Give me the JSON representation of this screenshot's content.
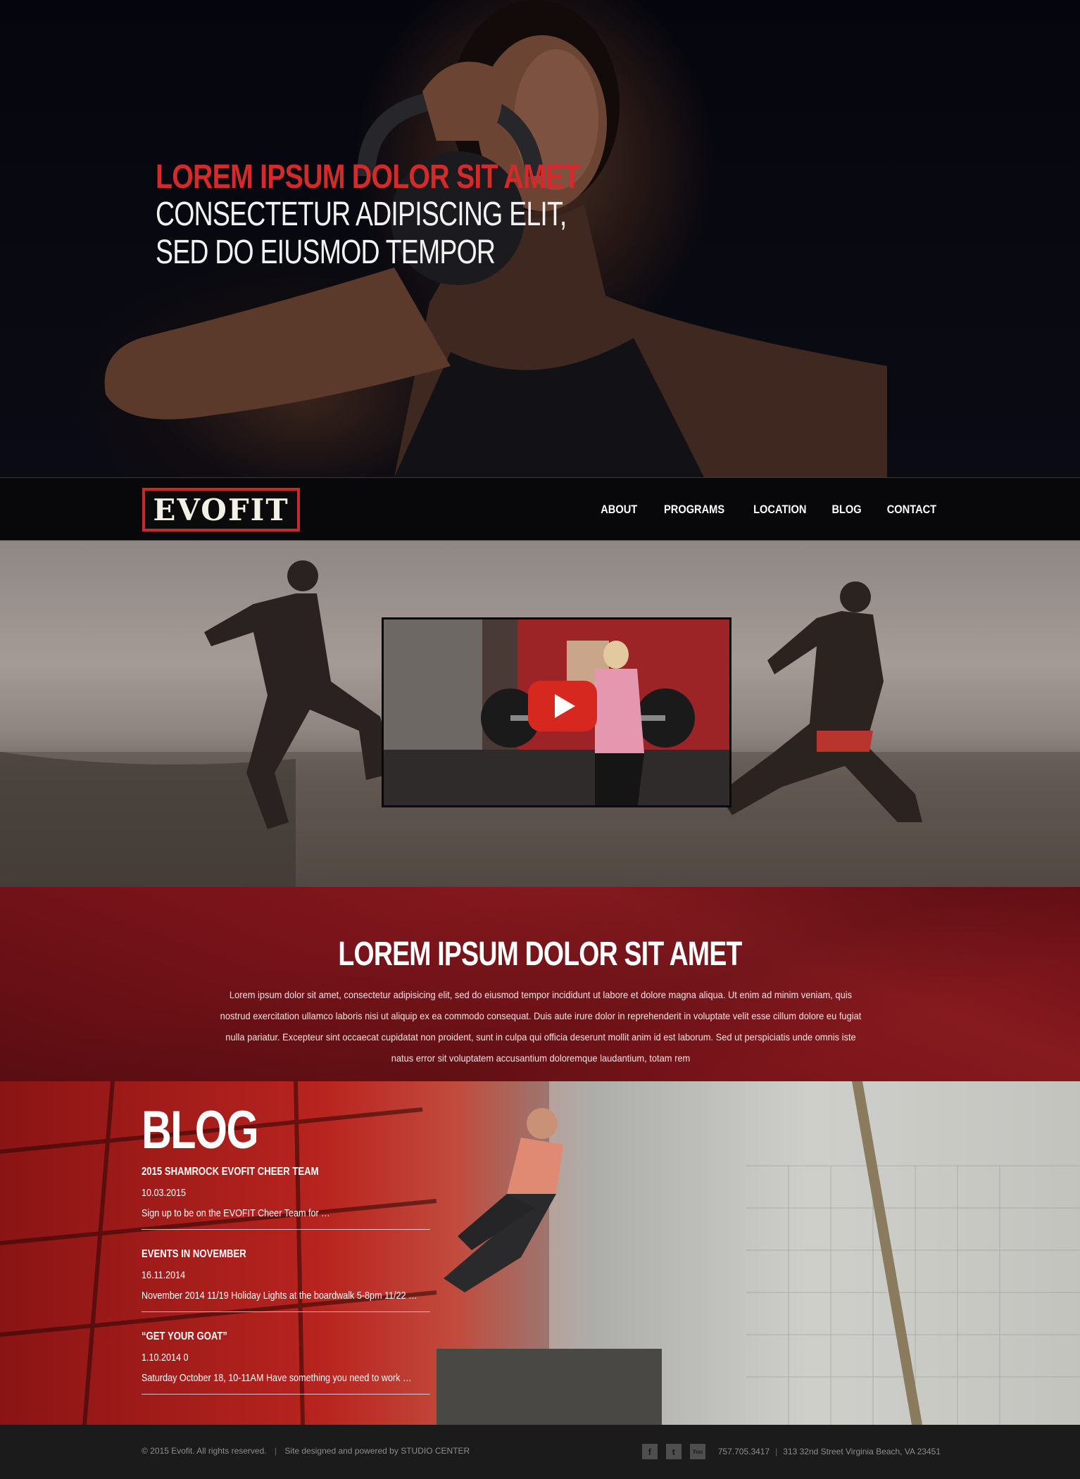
{
  "hero": {
    "line1": "LOREM IPSUM DOLOR SIT AMET",
    "line2": "CONSECTETUR ADIPISCING ELIT,",
    "line3": "SED DO EIUSMOD TEMPOR",
    "accent_color": "#d32a2a"
  },
  "nav": {
    "logo": "EVOFIT",
    "items": [
      "ABOUT",
      "PROGRAMS",
      "LOCATION",
      "BLOG",
      "CONTACT"
    ]
  },
  "video": {
    "icon": "play-icon",
    "button_color": "#d7281f"
  },
  "about": {
    "title": "LOREM IPSUM DOLOR SIT AMET",
    "body": "Lorem ipsum dolor sit amet, consectetur adipisicing elit, sed do eiusmod tempor incididunt ut labore et dolore magna aliqua. Ut enim ad minim veniam, quis nostrud exercitation ullamco laboris nisi ut aliquip ex ea commodo consequat. Duis aute irure dolor in reprehenderit in voluptate velit esse cillum dolore eu fugiat nulla pariatur. Excepteur sint occaecat cupidatat non proident, sunt in culpa qui officia deserunt mollit anim id est laborum. Sed ut perspiciatis unde omnis iste natus error sit voluptatem accusantium doloremque laudantium, totam rem",
    "bg_color": "#7a141a"
  },
  "blog": {
    "title": "BLOG",
    "posts": [
      {
        "title": "2015 SHAMROCK EVOFIT CHEER TEAM",
        "date": "10.03.2015",
        "excerpt": "Sign up to be on the EVOFIT Cheer Team for …"
      },
      {
        "title": "EVENTS IN NOVEMBER",
        "date": "16.11.2014",
        "excerpt": "November 2014  11/19 Holiday Lights at the boardwalk 5-8pm 11/22 …"
      },
      {
        "title": "“GET YOUR GOAT”",
        "date": "1.10.2014 0",
        "excerpt": "Saturday October 18, 10-11AM Have something you need to work …"
      }
    ]
  },
  "footer": {
    "copyright": "© 2015 Evofit. All rights reserved.",
    "divider": "|",
    "credit": "Site designed and powered by STUDIO CENTER",
    "social": [
      {
        "icon": "facebook-icon",
        "glyph": "f"
      },
      {
        "icon": "twitter-icon",
        "glyph": "t"
      },
      {
        "icon": "youtube-icon",
        "glyph": "You"
      }
    ],
    "phone": "757.705.3417",
    "address": "313 32nd Street Virginia Beach, VA 23451"
  }
}
